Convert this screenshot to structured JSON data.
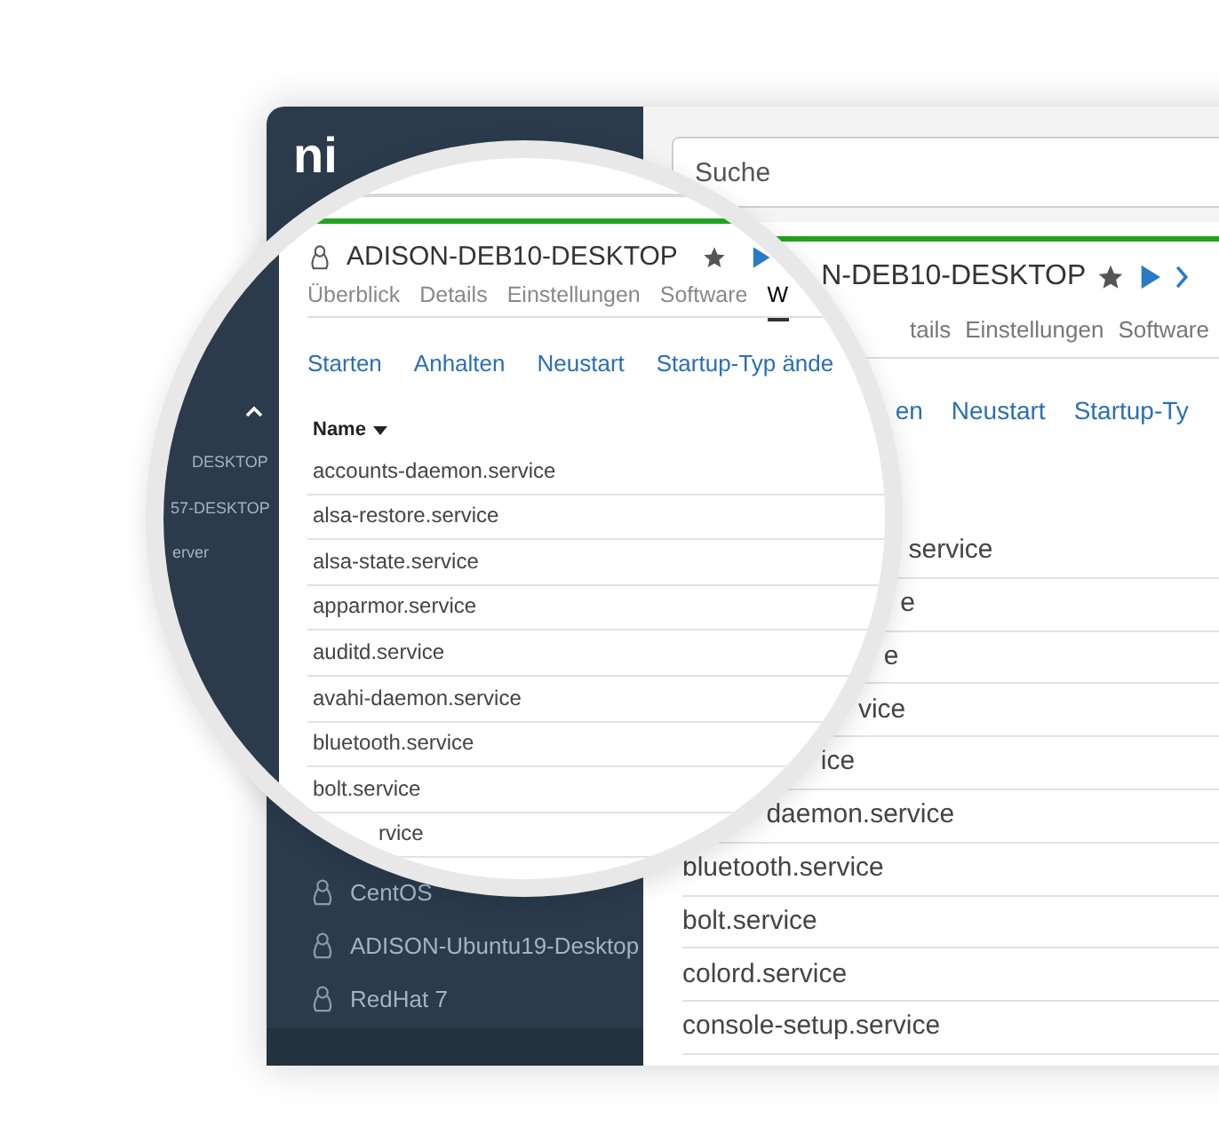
{
  "background": {
    "logo": "ni",
    "sidebar_items": [
      "CentOS",
      "ADISON-Ubuntu19-Desktop",
      "RedHat 7"
    ],
    "search": {
      "placeholder": "Suche"
    },
    "title": "N-DEB10-DESKTOP",
    "tabs": [
      {
        "label": "tails",
        "selected": false
      },
      {
        "label": "Einstellungen",
        "selected": false
      },
      {
        "label": "Software",
        "selected": false
      }
    ],
    "actions": [
      "en",
      "Neustart",
      "Startup-Ty"
    ],
    "rows": [
      "service",
      "e",
      "e",
      "vice",
      "ice",
      "daemon.service",
      "bluetooth.service",
      "bolt.service",
      "colord.service",
      "console-setup.service"
    ]
  },
  "magnifier": {
    "sidebar_items": [
      "DESKTOP",
      "57-DESKTOP",
      "erver"
    ],
    "title": "ADISON-DEB10-DESKTOP",
    "tabs": [
      {
        "label": "Überblick",
        "selected": false
      },
      {
        "label": "Details",
        "selected": false
      },
      {
        "label": "Einstellungen",
        "selected": false
      },
      {
        "label": "Software",
        "selected": false
      },
      {
        "label": "W",
        "selected": true
      }
    ],
    "actions": [
      "Starten",
      "Anhalten",
      "Neustart",
      "Startup-Typ ände"
    ],
    "column": "Name",
    "rows": [
      "accounts-daemon.service",
      "alsa-restore.service",
      "alsa-state.service",
      "apparmor.service",
      "auditd.service",
      "avahi-daemon.service",
      "bluetooth.service",
      "bolt.service",
      "rvice"
    ]
  }
}
